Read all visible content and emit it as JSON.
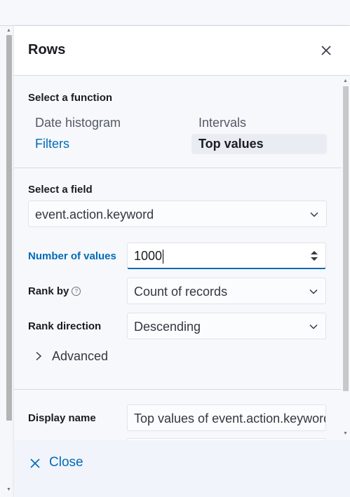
{
  "flyout": {
    "title": "Rows",
    "close_icon": "close-icon"
  },
  "function_section": {
    "label": "Select a function",
    "options": [
      {
        "label": "Date histogram",
        "state": "default"
      },
      {
        "label": "Intervals",
        "state": "default"
      },
      {
        "label": "Filters",
        "state": "link"
      },
      {
        "label": "Top values",
        "state": "selected"
      }
    ]
  },
  "field_section": {
    "label": "Select a field",
    "value": "event.action.keyword",
    "icon": "chevron-down-icon"
  },
  "number_of_values": {
    "label": "Number of values",
    "value": "1000"
  },
  "rank_by": {
    "label": "Rank by",
    "value": "Count of records",
    "help_icon": "?"
  },
  "rank_direction": {
    "label": "Rank direction",
    "value": "Descending"
  },
  "advanced": {
    "label": "Advanced"
  },
  "display_name": {
    "label": "Display name",
    "value": "Top values of event.action.keyword"
  },
  "footer": {
    "close_label": "Close"
  },
  "colors": {
    "accent": "#006bb8",
    "text": "#343741",
    "panel_bg": "#f7f8fc"
  }
}
